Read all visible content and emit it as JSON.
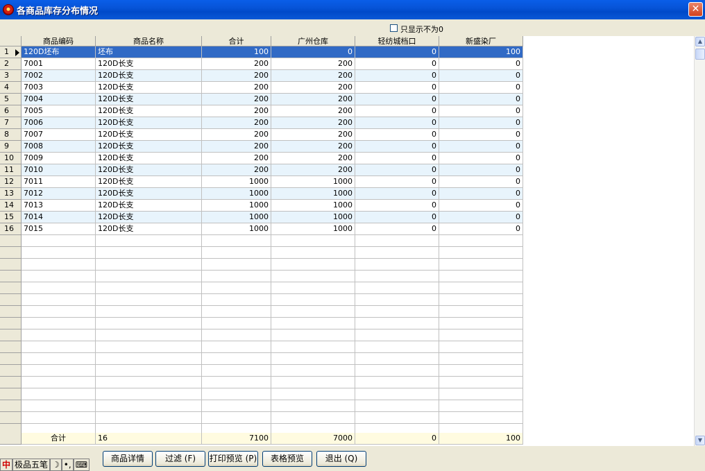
{
  "window": {
    "title": "各商品库存分布情况",
    "close_label": "✕"
  },
  "filter": {
    "only_nonzero_label": "只显示不为0",
    "checked": false
  },
  "table": {
    "headers": [
      "商品编码",
      "商品名称",
      "合计",
      "广州仓库",
      "轻纺城档口",
      "新盛染厂"
    ],
    "rows": [
      [
        "1",
        "120D坯布",
        "坯布",
        "100",
        "0",
        "0",
        "100"
      ],
      [
        "2",
        "7001",
        "120D长支",
        "200",
        "200",
        "0",
        "0"
      ],
      [
        "3",
        "7002",
        "120D长支",
        "200",
        "200",
        "0",
        "0"
      ],
      [
        "4",
        "7003",
        "120D长支",
        "200",
        "200",
        "0",
        "0"
      ],
      [
        "5",
        "7004",
        "120D长支",
        "200",
        "200",
        "0",
        "0"
      ],
      [
        "6",
        "7005",
        "120D长支",
        "200",
        "200",
        "0",
        "0"
      ],
      [
        "7",
        "7006",
        "120D长支",
        "200",
        "200",
        "0",
        "0"
      ],
      [
        "8",
        "7007",
        "120D长支",
        "200",
        "200",
        "0",
        "0"
      ],
      [
        "9",
        "7008",
        "120D长支",
        "200",
        "200",
        "0",
        "0"
      ],
      [
        "10",
        "7009",
        "120D长支",
        "200",
        "200",
        "0",
        "0"
      ],
      [
        "11",
        "7010",
        "120D长支",
        "200",
        "200",
        "0",
        "0"
      ],
      [
        "12",
        "7011",
        "120D长支",
        "1000",
        "1000",
        "0",
        "0"
      ],
      [
        "13",
        "7012",
        "120D长支",
        "1000",
        "1000",
        "0",
        "0"
      ],
      [
        "14",
        "7013",
        "120D长支",
        "1000",
        "1000",
        "0",
        "0"
      ],
      [
        "15",
        "7014",
        "120D长支",
        "1000",
        "1000",
        "0",
        "0"
      ],
      [
        "16",
        "7015",
        "120D长支",
        "1000",
        "1000",
        "0",
        "0"
      ]
    ],
    "footer": [
      "合计",
      "16",
      "7100",
      "7000",
      "0",
      "100"
    ]
  },
  "buttons": {
    "detail": "商品详情",
    "filter": "过滤 (F)",
    "print_preview": "打印预览 (P)",
    "grid_preview": "表格预览",
    "exit": "退出 (Q)"
  },
  "ime": {
    "lang": "中",
    "name": "极品五笔",
    "moon": "☽",
    "punct": "•,",
    "keyboard": "⌨"
  },
  "colors": {
    "title_bar": "#0754d8",
    "selected_row": "#316ac5",
    "alt_row": "#e8f4fc",
    "footer_row": "#fffbe0"
  }
}
